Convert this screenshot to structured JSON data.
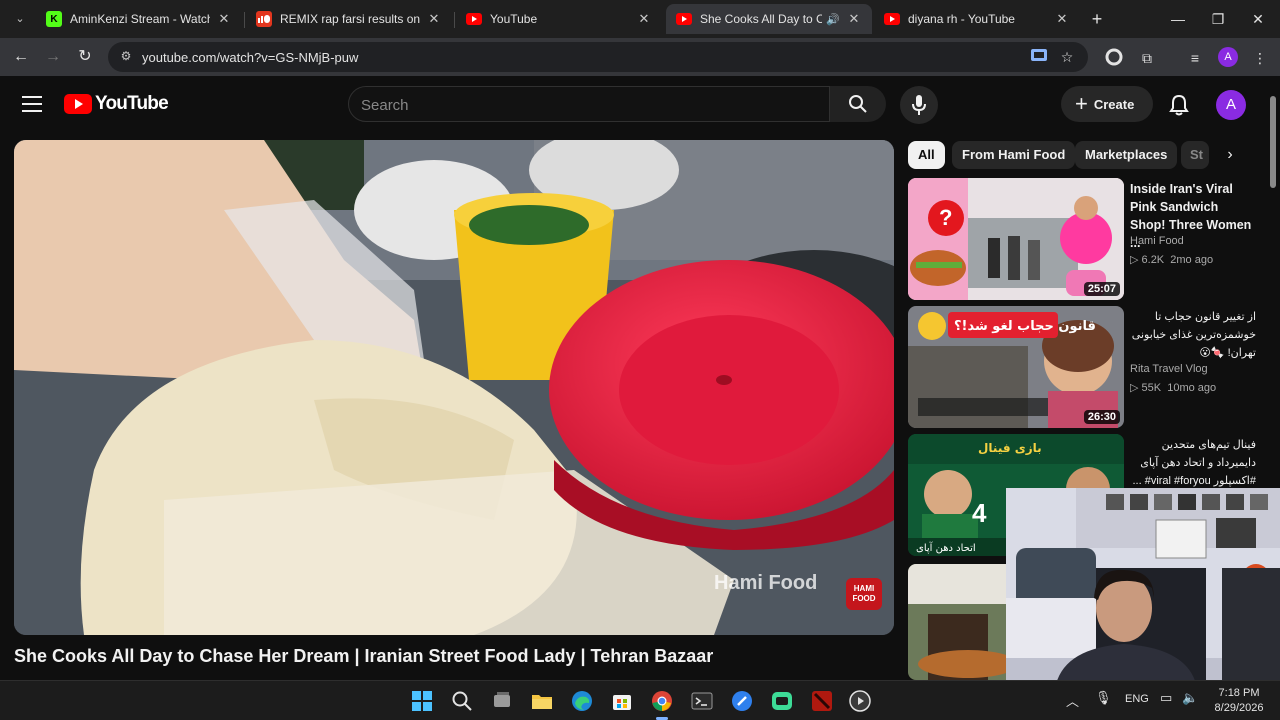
{
  "browser": {
    "tabs": [
      {
        "title": "AminKenzi Stream - Watch Liv",
        "favicon": "kick-icon",
        "active": false
      },
      {
        "title": "REMIX rap farsi results on Sou",
        "favicon": "soundcloud-icon",
        "active": false
      },
      {
        "title": "YouTube",
        "favicon": "youtube-icon",
        "active": false
      },
      {
        "title": "She Cooks All Day to Chas",
        "favicon": "youtube-icon",
        "active": true,
        "audio": true
      },
      {
        "title": "diyana rh - YouTube",
        "favicon": "youtube-icon",
        "active": false
      }
    ],
    "url": "youtube.com/watch?v=GS-NMjB-puw",
    "profile_initial": "A"
  },
  "youtube": {
    "logo_text": "YouTube",
    "search_placeholder": "Search",
    "create_label": "Create",
    "avatar_initial": "A",
    "video_title": "She Cooks All Day to Chase Her Dream | Iranian Street Food Lady | Tehran Bazaar",
    "video_watermark": "Hami Food",
    "watermark_badge": "HAMI FOOD",
    "chips": [
      "All",
      "From Hami Food",
      "Marketplaces",
      "St"
    ],
    "recommendations": [
      {
        "title": "Inside Iran's Viral Pink Sandwich Shop! Three Women ...",
        "channel": "Hami Food",
        "views": "6.2K",
        "age": "2mo ago",
        "duration": "25:07"
      },
      {
        "title": "از تغییر قانون حجاب تا خوشمزه‌ترین غذای خیابونی تهران! 🍬😮",
        "channel": "Rita Travel Vlog",
        "views": "55K",
        "age": "10mo ago",
        "duration": "26:30",
        "thumb_text": "قانون حجاب لغو شد!؟"
      },
      {
        "title": "فینال تیم‌های متحدین دایمیرداد و اتحاد دهن آپای #اکسپلور viral #foryou# ...",
        "thumb_text": "بازی فینال",
        "thumb_number": "4",
        "thumb_caption": "اتحاد دهن آپای"
      },
      {
        "title": ""
      }
    ]
  },
  "taskbar": {
    "language": "ENG",
    "time": "7:18 PM",
    "date": "8/29/2026"
  },
  "colors": {
    "yt_red": "#ff0000",
    "background": "#0f0f0f",
    "chip_active": "#f1f1f1",
    "avatar": "#8a2be2"
  }
}
